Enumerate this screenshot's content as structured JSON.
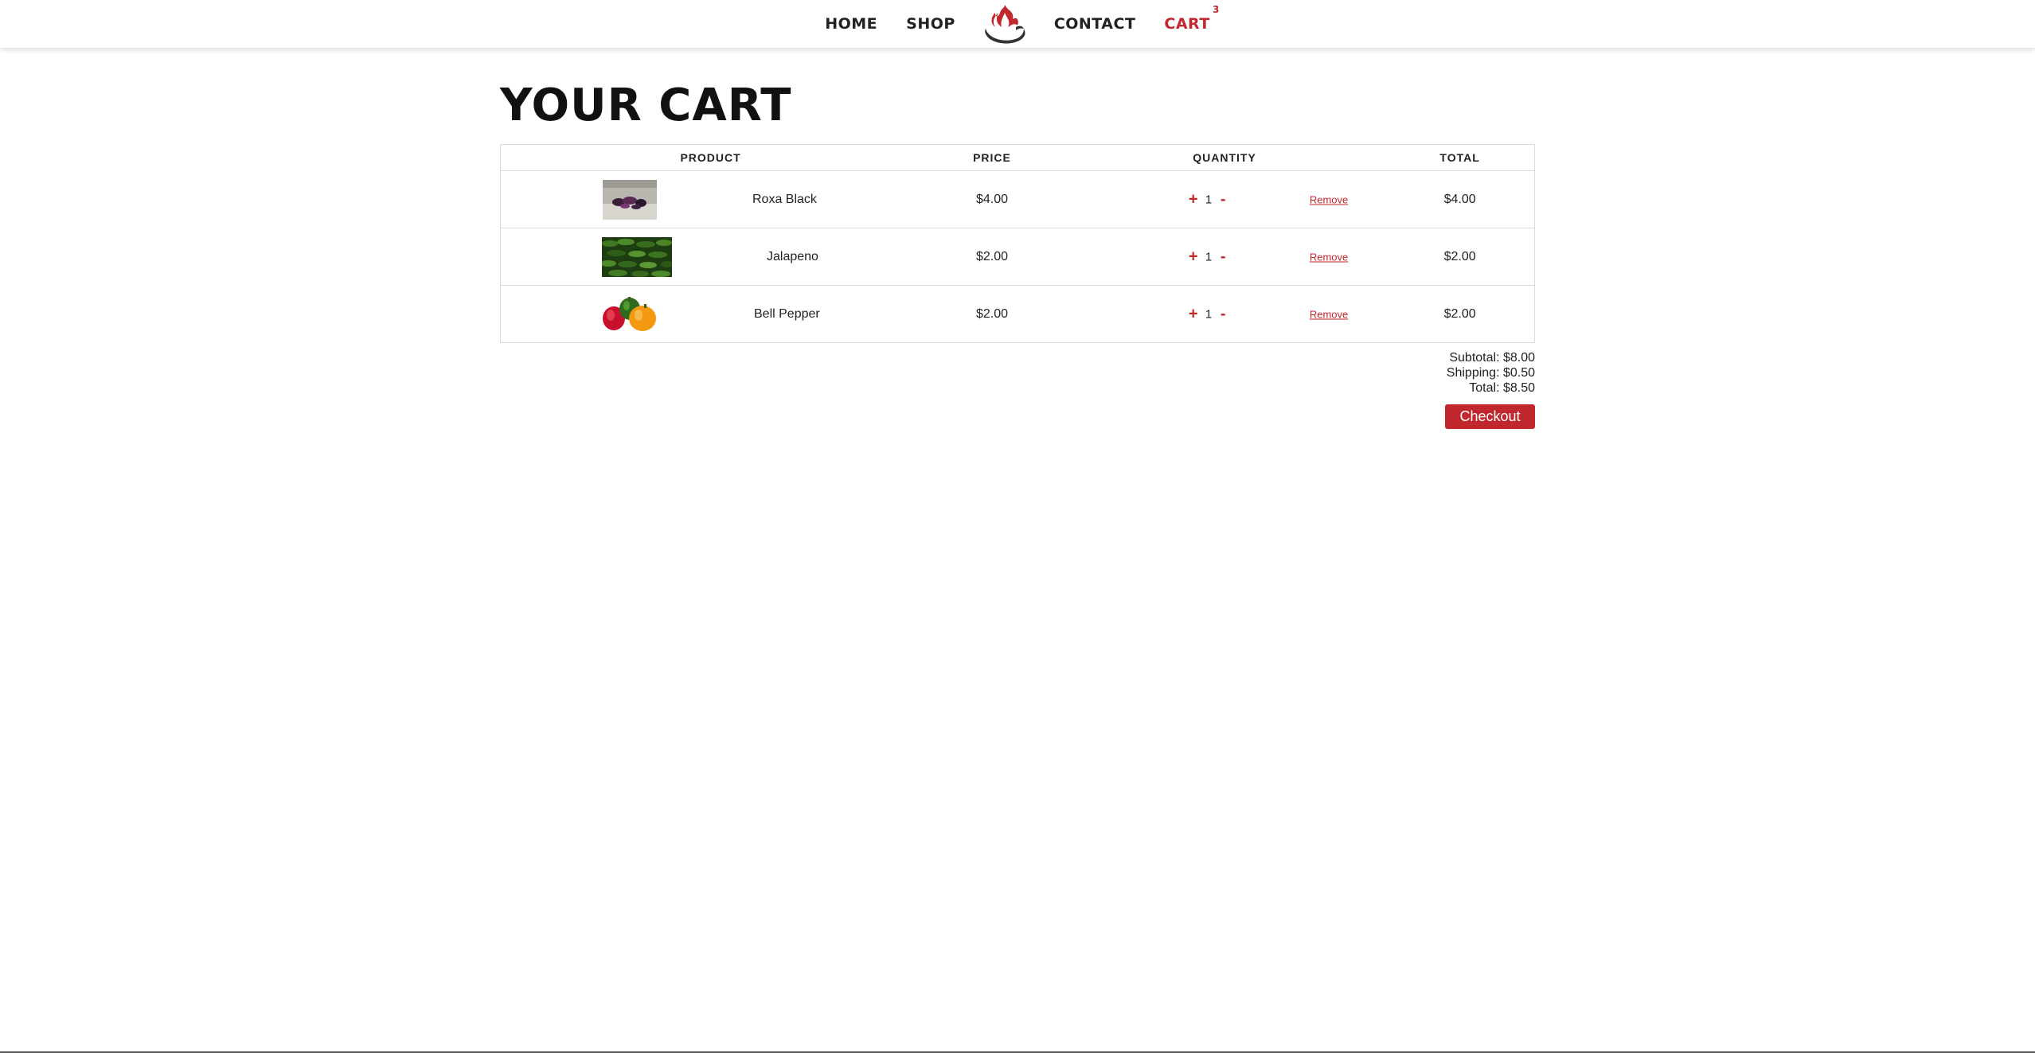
{
  "nav": {
    "home": "HOME",
    "shop": "SHOP",
    "contact": "CONTACT",
    "cart": "CART",
    "cart_count": "3",
    "logo_icon": "flaming-pepper-logo"
  },
  "page": {
    "title": "YOUR CART"
  },
  "table": {
    "headers": {
      "product": "PRODUCT",
      "price": "PRICE",
      "quantity": "QUANTITY",
      "total": "TOTAL"
    },
    "rows": [
      {
        "name": "Roxa Black",
        "price": "$4.00",
        "qty": "1",
        "plus": "+",
        "minus": "-",
        "remove": "Remove",
        "total": "$4.00",
        "image": "roxa-black-pepper-photo"
      },
      {
        "name": "Jalapeno",
        "price": "$2.00",
        "qty": "1",
        "plus": "+",
        "minus": "-",
        "remove": "Remove",
        "total": "$2.00",
        "image": "jalapeno-pepper-photo"
      },
      {
        "name": "Bell Pepper",
        "price": "$2.00",
        "qty": "1",
        "plus": "+",
        "minus": "-",
        "remove": "Remove",
        "total": "$2.00",
        "image": "bell-pepper-photo"
      }
    ]
  },
  "summary": {
    "subtotal": "Subtotal: $8.00",
    "shipping": "Shipping: $0.50",
    "total": "Total: $8.50"
  },
  "checkout_label": "Checkout",
  "colors": {
    "accent": "#c0282e",
    "text": "#222222",
    "border": "#dcdcdc"
  }
}
